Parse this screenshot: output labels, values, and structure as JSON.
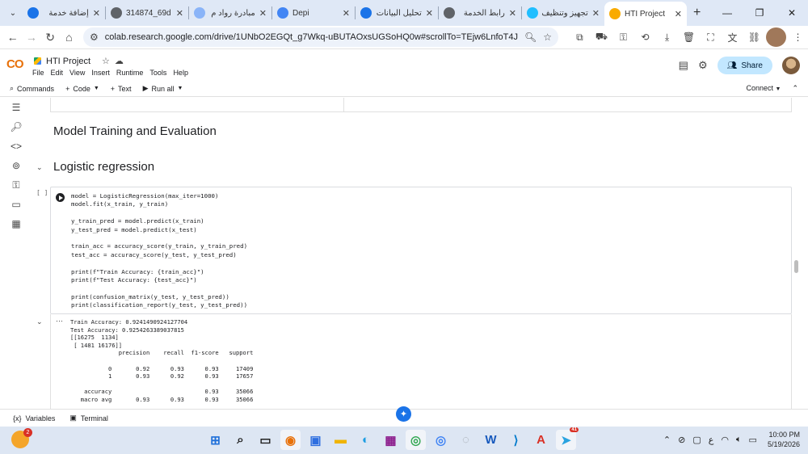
{
  "browser": {
    "tabs": [
      {
        "title": "إضافة خدمة",
        "icon": "colab-icon-ar",
        "color": "#1a73e8"
      },
      {
        "title": "314874_69d",
        "icon": "globe-icon",
        "color": "#5f6368"
      },
      {
        "title": "مبادرة رواد م",
        "icon": "gov-icon",
        "color": "#8ab4f8"
      },
      {
        "title": "Depi",
        "icon": "depi-icon",
        "color": "#4285f4"
      },
      {
        "title": "تحليل البيانات",
        "icon": "colab-icon-ar",
        "color": "#1a73e8"
      },
      {
        "title": "رابط الخدمة",
        "icon": "globe-icon",
        "color": "#5f6368"
      },
      {
        "title": "تجهيز وتنظيف",
        "icon": "kaggle-icon",
        "color": "#20beff"
      },
      {
        "title": "HTI Project",
        "icon": "colab-icon",
        "color": "#f9ab00",
        "active": true
      }
    ],
    "new_tab": "+",
    "url": "colab.research.google.com/drive/1UNbO2EGQt_g7Wkq-uBUTAOxsUGSoHQ0w#scrollTo=TEjw6LnfoT4J"
  },
  "colab": {
    "logo": "CO",
    "notebook_title": "HTI Project",
    "menu": [
      "File",
      "Edit",
      "View",
      "Insert",
      "Runtime",
      "Tools",
      "Help"
    ],
    "share_label": "Share",
    "toolbar": {
      "commands": "Commands",
      "code": "Code",
      "text": "Text",
      "run_all": "Run all",
      "connect": "Connect"
    }
  },
  "notebook": {
    "section_title": "Model Training and Evaluation",
    "subsection_title": "Logistic regression",
    "cell_bracket": "[ ]",
    "code_lines": [
      "model = LogisticRegression(max_iter=1000)",
      "model.fit(x_train, y_train)",
      "",
      "y_train_pred = model.predict(x_train)",
      "y_test_pred = model.predict(x_test)",
      "",
      "train_acc = accuracy_score(y_train, y_train_pred)",
      "test_acc = accuracy_score(y_test, y_test_pred)",
      "",
      "print(f\"Train Accuracy: {train_acc}\")",
      "print(f\"Test Accuracy: {test_acc}\")",
      "",
      "print(confusion_matrix(y_test, y_test_pred))",
      "print(classification_report(y_test, y_test_pred))"
    ],
    "output_lines": [
      "Train Accuracy: 0.9241490924127704",
      "Test Accuracy: 0.9254263389037815",
      "[[16275  1134]",
      " [ 1481 16176]]",
      "              precision    recall  f1-score   support",
      "",
      "           0       0.92      0.93      0.93     17409",
      "           1       0.93      0.92      0.93     17657",
      "",
      "    accuracy                           0.93     35066",
      "   macro avg       0.93      0.93      0.93     35066"
    ]
  },
  "statusbar": {
    "variables": "Variables",
    "terminal": "Terminal"
  },
  "taskbar": {
    "weather_badge": "2",
    "apps": [
      {
        "name": "windows-start-icon",
        "color": "#1e6fd9",
        "glyph": "⊞"
      },
      {
        "name": "search-icon",
        "color": "#222222",
        "glyph": "⌕"
      },
      {
        "name": "task-view-icon",
        "color": "#222222",
        "glyph": "▭"
      },
      {
        "name": "copilot-icon",
        "color": "#e8710a",
        "glyph": "◉",
        "active": true
      },
      {
        "name": "store-icon",
        "color": "#2d6ee0",
        "glyph": "▣"
      },
      {
        "name": "file-explorer-icon",
        "color": "#f0b400",
        "glyph": "▬"
      },
      {
        "name": "edge-icon",
        "color": "#1b9de2",
        "glyph": "◐"
      },
      {
        "name": "winrar-icon",
        "color": "#8b1a8b",
        "glyph": "▦"
      },
      {
        "name": "chrome-icon",
        "color": "#34a853",
        "glyph": "◎",
        "active": true
      },
      {
        "name": "chrome-profile-icon",
        "color": "#4285f4",
        "glyph": "◎"
      },
      {
        "name": "app-icon",
        "color": "#9aa0a6",
        "glyph": "◌"
      },
      {
        "name": "word-icon",
        "color": "#185abd",
        "glyph": "W"
      },
      {
        "name": "vscode-icon",
        "color": "#007acc",
        "glyph": "⟩"
      },
      {
        "name": "acrobat-icon",
        "color": "#d93025",
        "glyph": "A"
      },
      {
        "name": "telegram-icon",
        "color": "#2aa3e0",
        "glyph": "➤",
        "badge": "41",
        "active": true
      }
    ],
    "lang": "ع",
    "time": "10:00 PM",
    "date": "5/19/2026"
  }
}
